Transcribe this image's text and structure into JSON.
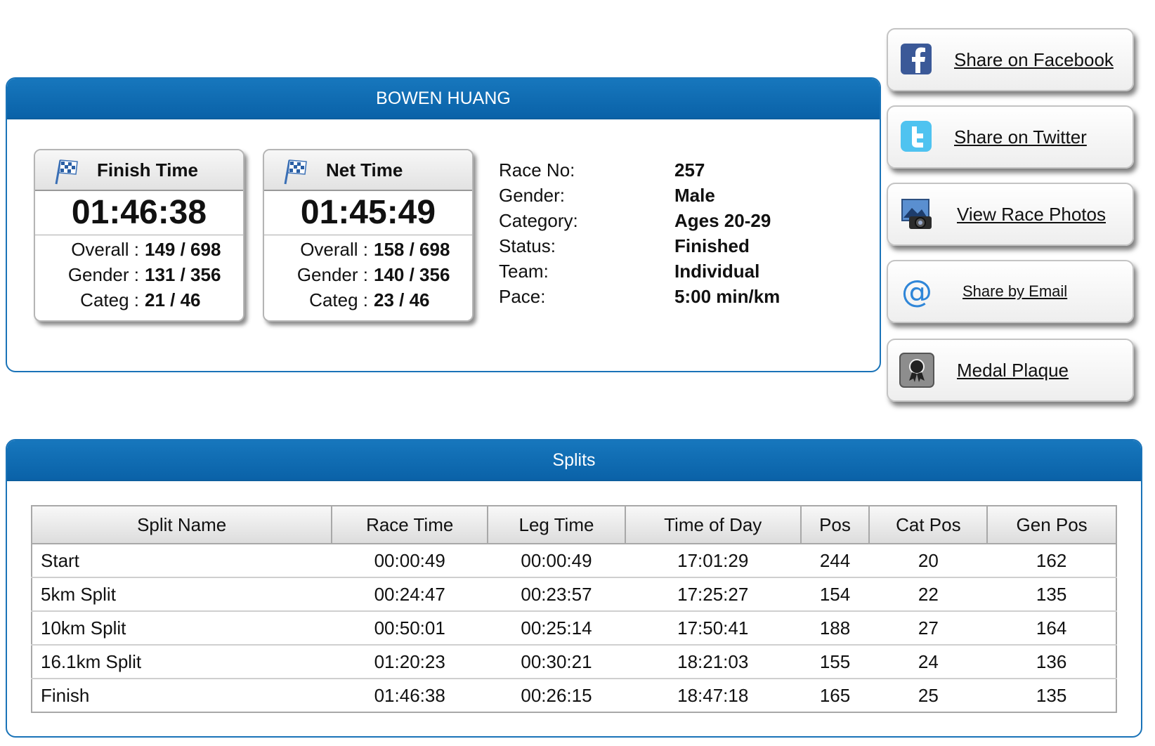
{
  "athlete": {
    "name": "BOWEN HUANG",
    "finish_card": {
      "title": "Finish Time",
      "time": "01:46:38",
      "overall_label": "Overall :",
      "overall_value": "149 / 698",
      "gender_label": "Gender :",
      "gender_value": "131 / 356",
      "categ_label": "Categ :",
      "categ_value": "21 / 46"
    },
    "net_card": {
      "title": "Net Time",
      "time": "01:45:49",
      "overall_label": "Overall :",
      "overall_value": "158 / 698",
      "gender_label": "Gender :",
      "gender_value": "140 / 356",
      "categ_label": "Categ :",
      "categ_value": "23 / 46"
    },
    "info": [
      {
        "label": "Race No:",
        "value": "257"
      },
      {
        "label": "Gender:",
        "value": "Male"
      },
      {
        "label": "Category:",
        "value": "Ages 20-29"
      },
      {
        "label": "Status:",
        "value": "Finished"
      },
      {
        "label": "Team:",
        "value": "Individual"
      },
      {
        "label": "Pace:",
        "value": "5:00 min/km"
      }
    ]
  },
  "share": [
    {
      "label": "Share on Facebook",
      "icon": "facebook-icon"
    },
    {
      "label": "Share on Twitter",
      "icon": "twitter-icon"
    },
    {
      "label": "View Race Photos",
      "icon": "camera-icon"
    },
    {
      "label": "Share by Email",
      "icon": "email-icon"
    },
    {
      "label": "Medal Plaque",
      "icon": "medal-icon"
    }
  ],
  "splits": {
    "title": "Splits",
    "columns": [
      "Split Name",
      "Race Time",
      "Leg Time",
      "Time of Day",
      "Pos",
      "Cat Pos",
      "Gen Pos"
    ],
    "rows": [
      [
        "Start",
        "00:00:49",
        "00:00:49",
        "17:01:29",
        "244",
        "20",
        "162"
      ],
      [
        "5km Split",
        "00:24:47",
        "00:23:57",
        "17:25:27",
        "154",
        "22",
        "135"
      ],
      [
        "10km Split",
        "00:50:01",
        "00:25:14",
        "17:50:41",
        "188",
        "27",
        "164"
      ],
      [
        "16.1km Split",
        "01:20:23",
        "00:30:21",
        "18:21:03",
        "155",
        "24",
        "136"
      ],
      [
        "Finish",
        "01:46:38",
        "00:26:15",
        "18:47:18",
        "165",
        "25",
        "135"
      ]
    ]
  },
  "colors": {
    "header_blue": "#0a62a8",
    "border_blue": "#1a73b8"
  }
}
